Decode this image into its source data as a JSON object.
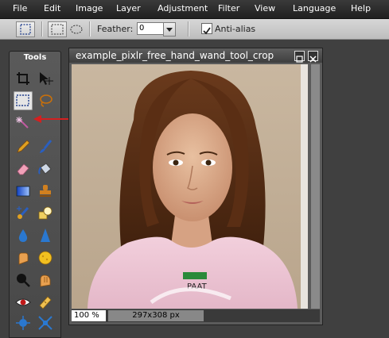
{
  "menu": [
    "File",
    "Edit",
    "Image",
    "Layer",
    "Adjustment",
    "Filter",
    "View",
    "Language",
    "Help"
  ],
  "options": {
    "feather_label": "Feather:",
    "feather_value": "0",
    "antialias_label": "Anti-alias",
    "antialias_checked": true
  },
  "tools_panel": {
    "title": "Tools",
    "tools": [
      "crop-icon",
      "move-icon",
      "marquee-icon",
      "lasso-icon",
      "magic-wand-icon",
      "pencil-icon",
      "brush-icon",
      "eraser-icon",
      "bucket-icon",
      "gradient-icon",
      "stamp-icon",
      "color-replace-icon",
      "drawing-icon",
      "blur-icon",
      "sharpen-icon",
      "smudge-icon",
      "sponge-icon",
      "dodge-icon",
      "burn-icon",
      "red-eye-icon",
      "spot-heal-icon",
      "bloat-icon",
      "pinch-icon"
    ],
    "active_tool": "marquee-icon"
  },
  "image_window": {
    "title": "example_pixlr_free_hand_wand_tool_crop",
    "zoom": "100 %",
    "dimensions": "297x308 px",
    "shirt_text": "PAAT"
  },
  "colors": {
    "accent_red": "#d42020",
    "active_tool_bg": "#e5e5e5"
  }
}
